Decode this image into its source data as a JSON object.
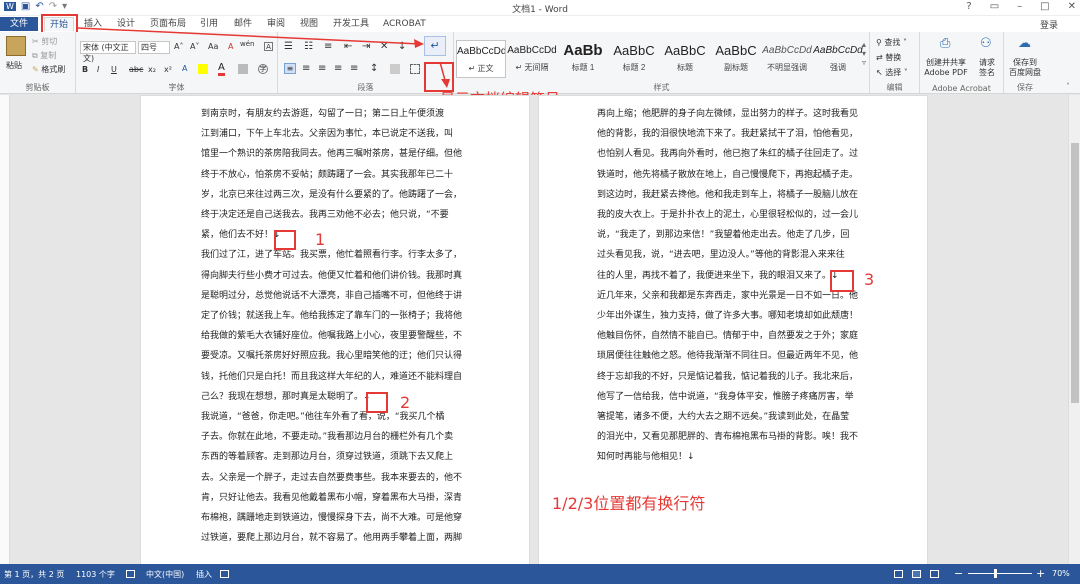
{
  "window": {
    "title": "文档1 - Word",
    "login": "登录",
    "help": "?",
    "min": "–",
    "max": "□",
    "close": "✕"
  },
  "tabs": [
    "文件",
    "开始",
    "插入",
    "设计",
    "页面布局",
    "引用",
    "邮件",
    "审阅",
    "视图",
    "开发工具",
    "ACROBAT"
  ],
  "clipboard": {
    "paste": "粘贴",
    "cut": "剪切",
    "copy": "复制",
    "format_painter": "格式刷",
    "label": "剪贴板"
  },
  "font": {
    "name": "宋体 (中文正文)",
    "size": "四号",
    "label": "字体",
    "bold": "B",
    "italic": "I",
    "underline": "U",
    "strike": "abc",
    "sub": "x₂",
    "sup": "x²",
    "clear": "A",
    "grow": "A˄",
    "shrink": "A˅",
    "case": "Aa",
    "phon": "wén"
  },
  "paragraph": {
    "label": "段落",
    "show_marks": "↵"
  },
  "styles": {
    "label": "样式",
    "items": [
      {
        "preview": "AaBbCcDd",
        "name": "↵ 正文"
      },
      {
        "preview": "AaBbCcDd",
        "name": "↵ 无间隔"
      },
      {
        "preview": "AaBb",
        "name": "标题 1"
      },
      {
        "preview": "AaBbC",
        "name": "标题 2"
      },
      {
        "preview": "AaBbC",
        "name": "标题"
      },
      {
        "preview": "AaBbC",
        "name": "副标题"
      },
      {
        "preview": "AaBbCcDd",
        "name": "不明显强调"
      },
      {
        "preview": "AaBbCcDd",
        "name": "强调"
      }
    ]
  },
  "editing": {
    "find": "查找 ˅",
    "replace": "替换",
    "select": "选择 ˅",
    "label": "编辑"
  },
  "acrobat": {
    "create": "创建并共享",
    "create2": "Adobe PDF",
    "request": "请求",
    "request2": "签名",
    "label": "Adobe Acrobat"
  },
  "save": {
    "btn": "保存到",
    "btn2": "百度网盘",
    "label": "保存"
  },
  "annotations": {
    "show_marks": "显示文档编辑符号",
    "m1": "1",
    "m2": "2",
    "m3": "3",
    "bottom": "1/2/3位置都有换行符"
  },
  "page1": [
    "到南京时，有朋友约去游逛，勾留了一日；第二日上午便须渡",
    "江到浦口，下午上车北去。父亲因为事忙，本已说定不送我，叫",
    "馆里一个熟识的茶房陪我同去。他再三嘱咐茶房，甚是仔细。但他",
    "终于不放心，怕茶房不妥帖；颇踌躇了一会。其实我那年已二十",
    "岁，北京已来往过两三次，是没有什么要紧的了。他踌躇了一会，",
    "终于决定还是自己送我去。我再三劝他不必去；他只说，“不要",
    "紧，他们去不好！↓",
    "我们过了江，进了车站。我买票，他忙着照看行李。行李太多了，",
    "得向脚夫行些小费才可过去。他便又忙着和他们讲价钱。我那时真",
    "是聪明过分，总觉他说话不大漂亮，非自己插嘴不可，但他终于讲",
    "定了价钱；就送我上车。他给我拣定了靠车门的一张椅子；我将他",
    "给我做的紫毛大衣铺好座位。他嘱我路上小心，夜里要警醒些，不",
    "要受凉。又嘱托茶房好好照应我。我心里暗笑他的迂；他们只认得",
    "钱，托他们只是白托！而且我这样大年纪的人，难道还不能料理自",
    "己么？我现在想想，那时真是太聪明了。↓",
    "我说道，“爸爸，你走吧。”他往车外看了看，说，“我买几个橘",
    "子去。你就在此地，不要走动。”我看那边月台的栅栏外有几个卖",
    "东西的等着顾客。走到那边月台，须穿过铁道，须跳下去又爬上",
    "去。父亲是一个胖子，走过去自然要费事些。我本来要去的，他不",
    "肯，只好让他去。我看见他戴着黑布小帽，穿着黑布大马褂，深青",
    "布棉袍，蹒跚地走到铁道边，慢慢探身下去，尚不大难。可是他穿",
    "过铁道，要爬上那边月台，就不容易了。他用两手攀着上面，两脚"
  ],
  "page2": [
    "再向上缩；他肥胖的身子向左微倾，显出努力的样子。这时我看见",
    "他的背影，我的泪很快地流下来了。我赶紧拭干了泪，怕他看见，",
    "也怕别人看见。我再向外看时，他已抱了朱红的橘子往回走了。过",
    "铁道时，他先将橘子散放在地上，自己慢慢爬下，再抱起橘子走。",
    "到这边时，我赶紧去搀他。他和我走到车上，将橘子一股脑儿放在",
    "我的皮大衣上。于是扑扑衣上的泥土，心里很轻松似的，过一会儿",
    "说，“我走了，到那边来信！”我望着他走出去。他走了几步，回",
    "过头看见我，说，“进去吧，里边没人。”等他的背影混入来来往",
    "往的人里，再找不着了，我便进来坐下，我的眼泪又来了。↓",
    "近几年来，父亲和我都是东奔西走，家中光景是一日不如一日。他",
    "少年出外谋生，独力支持，做了许多大事。哪知老境却如此颓唐！",
    "他触目伤怀，自然情不能自已。情郁于中，自然要发之于外；家庭",
    "琐屑便往往触他之怒。他待我渐渐不同往日。但最近两年不见，他",
    "终于忘却我的不好，只是惦记着我，惦记着我的儿子。我北来后，",
    "他写了一信给我，信中说道，“我身体平安，惟膀子疼痛厉害，举",
    "箸提笔，诸多不便，大约大去之期不远矣。”我读到此处，在晶莹",
    "的泪光中，又看见那肥胖的、青布棉袍黑布马褂的背影。唉！我不",
    "知何时再能与他相见！↓"
  ],
  "status": {
    "page": "第 1 页，共 2 页",
    "words": "1103 个字",
    "lang": "中文(中国)",
    "mode": "插入",
    "zoom": "70%",
    "minus": "−",
    "plus": "+"
  }
}
